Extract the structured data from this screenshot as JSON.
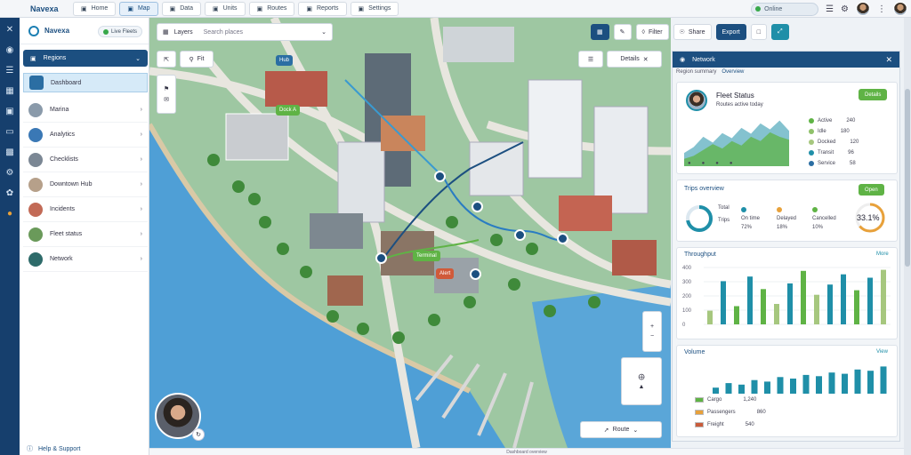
{
  "app": {
    "brand": "Navexa",
    "status_footer": "Dashboard overview"
  },
  "tabs": [
    {
      "label": "Home",
      "icon": "home-icon"
    },
    {
      "label": "Map",
      "icon": "map-icon"
    },
    {
      "label": "Data",
      "icon": "grid-icon"
    },
    {
      "label": "Units",
      "icon": "layers-icon"
    },
    {
      "label": "Routes",
      "icon": "route-icon"
    },
    {
      "label": "Reports",
      "icon": "chart-icon"
    },
    {
      "label": "Settings",
      "icon": "gear-icon"
    }
  ],
  "topbar": {
    "status_pill": "Online"
  },
  "sidebar": {
    "title": "Navexa",
    "stat_label": "Live Fleets",
    "dropdown_label": "Regions",
    "items": [
      {
        "label": "Dashboard",
        "color": "#2b6ea3"
      },
      {
        "label": "Marina",
        "color": "#8a9aaa"
      },
      {
        "label": "Analytics",
        "color": "#3a78b5"
      },
      {
        "label": "Checklists",
        "color": "#7b8794"
      },
      {
        "label": "Downtown Hub",
        "color": "#b6a08a"
      },
      {
        "label": "Incidents",
        "color": "#c26a56"
      },
      {
        "label": "Fleet status",
        "color": "#6a9a5a"
      },
      {
        "label": "Network",
        "color": "#2e6b6a"
      }
    ],
    "footer": "Help & Support"
  },
  "map": {
    "search_placeholder": "Search places",
    "toolbar_label": "Layers",
    "zoom_label": "Fit",
    "details_label": "Details",
    "route_label": "Route",
    "badges": [
      {
        "label": "Hub",
        "color": "#2b6ea3"
      },
      {
        "label": "Dock A",
        "color": "#5fb345"
      },
      {
        "label": "Terminal",
        "color": "#5fb345"
      },
      {
        "label": "Alert",
        "color": "#d05a3a"
      }
    ]
  },
  "right_toolbar": {
    "filter_label": "Filter",
    "share_label": "Share",
    "export_label": "Export"
  },
  "panel": {
    "title": "Network",
    "tab_active": "Overview",
    "subtitle": "Region summary",
    "trend": {
      "name": "Fleet Status",
      "caption": "Routes active today",
      "button": "Details",
      "chart_data": {
        "type": "area",
        "x": [
          0,
          1,
          2,
          3,
          4,
          5,
          6,
          7,
          8,
          9,
          10,
          11
        ],
        "series": [
          {
            "values": [
              18,
              26,
              40,
              32,
              45,
              38,
              52,
              44,
              58,
              50,
              62,
              48
            ],
            "color": "#1f8fa8"
          },
          {
            "values": [
              10,
              14,
              22,
              30,
              24,
              34,
              28,
              40,
              34,
              46,
              40,
              36
            ],
            "color": "#5fb345"
          }
        ]
      },
      "legend": [
        {
          "label": "Active",
          "value": "240",
          "color": "#5fb345"
        },
        {
          "label": "Idle",
          "value": "180",
          "color": "#8fc16a"
        },
        {
          "label": "Docked",
          "value": "120",
          "color": "#a6c77e"
        },
        {
          "label": "Transit",
          "value": "96",
          "color": "#1f8fa8"
        },
        {
          "label": "Service",
          "value": "58",
          "color": "#2b6ea3"
        }
      ]
    },
    "kpi": {
      "title": "Trips overview",
      "button": "Open",
      "ring_value": 0.72,
      "ring_label": "Total",
      "ring_sub": "Trips",
      "percent_value": 0.64,
      "percent_label": "33.1%",
      "items": [
        {
          "label": "On time",
          "value": "72%",
          "color": "#1f8fa8"
        },
        {
          "label": "Delayed",
          "value": "18%",
          "color": "#e8a13a"
        },
        {
          "label": "Cancelled",
          "value": "10%",
          "color": "#5fb345"
        }
      ]
    },
    "bars": {
      "title": "Throughput",
      "link": "More",
      "chart_data": {
        "type": "bar",
        "yticks": [
          "400",
          "300",
          "200",
          "100",
          "0"
        ],
        "values": [
          120,
          380,
          160,
          420,
          310,
          180,
          360,
          470,
          260,
          350,
          440,
          300,
          410,
          480
        ],
        "colors": [
          "#a6c77e",
          "#1f8fa8",
          "#5fb345",
          "#1f8fa8",
          "#5fb345",
          "#a6c77e",
          "#1f8fa8",
          "#5fb345",
          "#a6c77e",
          "#1f8fa8",
          "#1f8fa8",
          "#5fb345",
          "#1f8fa8",
          "#a6c77e"
        ]
      }
    },
    "volume": {
      "title": "Volume",
      "link": "View",
      "legend": [
        {
          "label": "Cargo",
          "value": "1,240",
          "color": "#5fb345"
        },
        {
          "label": "Passengers",
          "value": "860",
          "color": "#e8a13a"
        },
        {
          "label": "Freight",
          "value": "540",
          "color": "#c95b3a"
        }
      ],
      "chart_data": {
        "type": "bar",
        "values": [
          20,
          35,
          30,
          45,
          40,
          55,
          50,
          62,
          58,
          70,
          66,
          80,
          76,
          90
        ],
        "color": "#1f8fa8"
      }
    }
  }
}
